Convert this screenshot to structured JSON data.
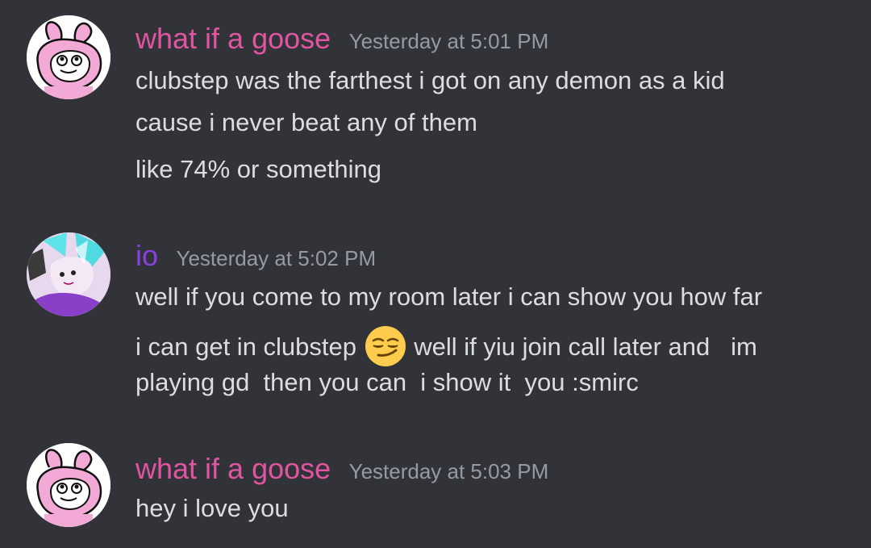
{
  "messages": [
    {
      "author": "what if a goose",
      "timestamp": "Yesterday at 5:01 PM",
      "avatar_icon": "pink-bunny-avatar",
      "lines": [
        "clubstep was the farthest i got on any demon as a kid",
        "cause i never beat any of them",
        "like 74% or something"
      ]
    },
    {
      "author": "io",
      "timestamp": "Yesterday at 5:02 PM",
      "avatar_icon": "purple-cyan-character-avatar",
      "lines": [
        "well if you come to my room later i can show you how far",
        "i can get in clubstep",
        "well if yiu join call later and   im",
        "playing gd  then you can  i show it  you :smirc"
      ],
      "inline_emoji": "smirking-face-emoji"
    },
    {
      "author": "what if a goose",
      "timestamp": "Yesterday at 5:03 PM",
      "avatar_icon": "pink-bunny-avatar",
      "lines": [
        "hey i love you"
      ]
    }
  ],
  "colors": {
    "background": "#313338",
    "goose_name": "#e0559f",
    "io_name": "#8a3fe0",
    "timestamp": "#949ba4",
    "message_text": "#dbdee1"
  }
}
